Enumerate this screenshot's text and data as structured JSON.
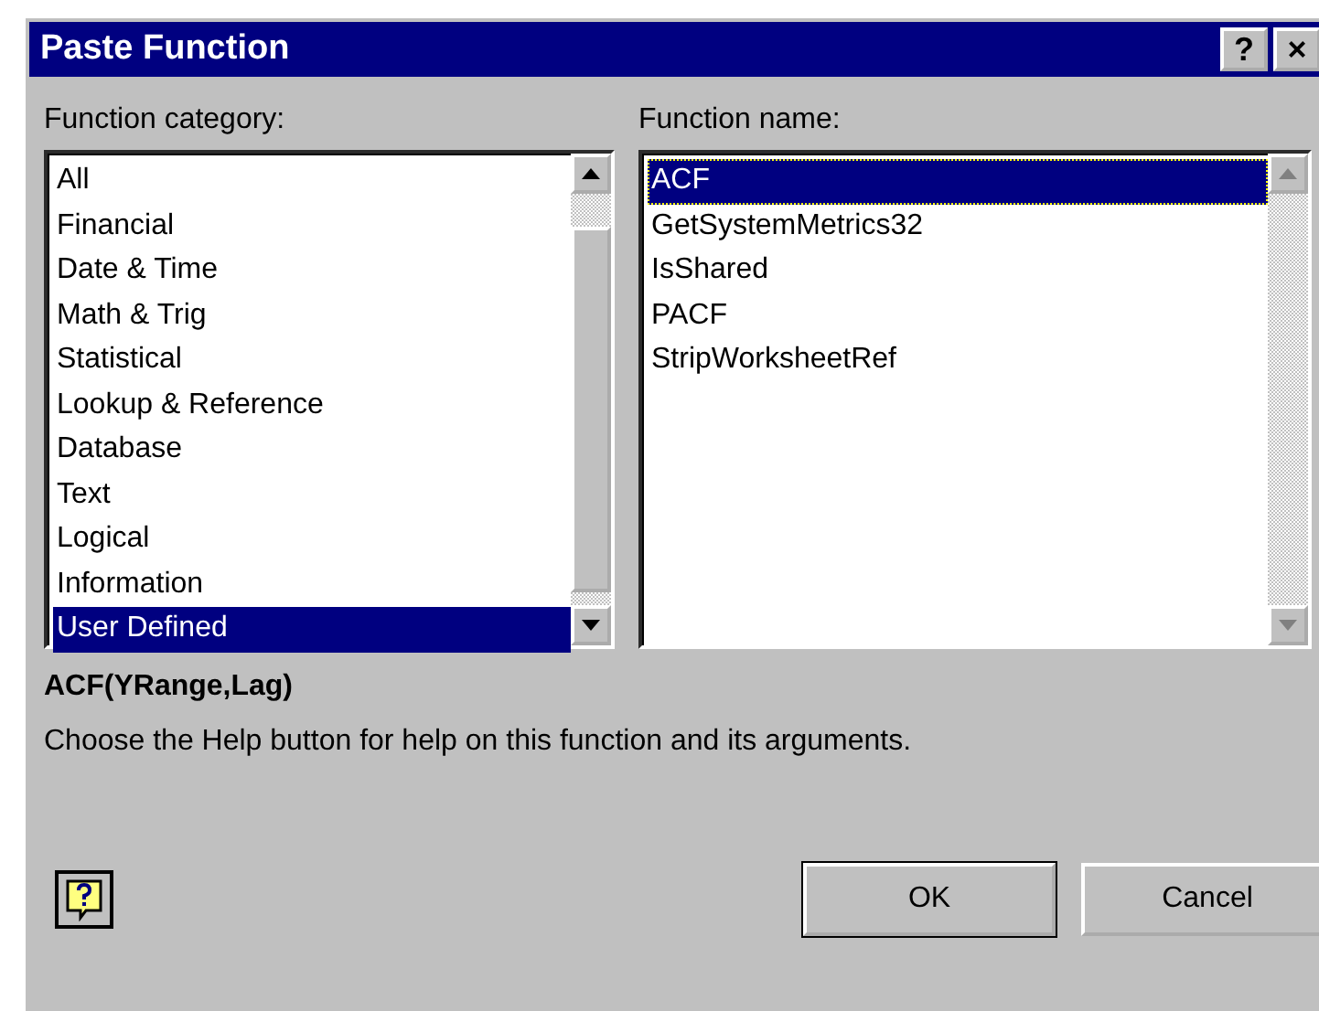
{
  "window": {
    "title": "Paste Function",
    "title_buttons": [
      "?",
      "×"
    ]
  },
  "category_list": {
    "label": "Function category:",
    "items": [
      {
        "label": "All",
        "selected": false
      },
      {
        "label": "Financial",
        "selected": false
      },
      {
        "label": "Date & Time",
        "selected": false
      },
      {
        "label": "Math & Trig",
        "selected": false
      },
      {
        "label": "Statistical",
        "selected": false
      },
      {
        "label": "Lookup & Reference",
        "selected": false
      },
      {
        "label": "Database",
        "selected": false
      },
      {
        "label": "Text",
        "selected": false
      },
      {
        "label": "Logical",
        "selected": false
      },
      {
        "label": "Information",
        "selected": false
      },
      {
        "label": "User Defined",
        "selected": true
      }
    ]
  },
  "name_list": {
    "label": "Function name:",
    "items": [
      {
        "label": "ACF",
        "selected": true
      },
      {
        "label": "GetSystemMetrics32",
        "selected": false
      },
      {
        "label": "IsShared",
        "selected": false
      },
      {
        "label": "PACF",
        "selected": false
      },
      {
        "label": "StripWorksheetRef",
        "selected": false
      }
    ]
  },
  "syntax": "ACF(YRange,Lag)",
  "description": "Choose the Help button for help on this function and its arguments.",
  "buttons": [
    "OK",
    "Cancel"
  ]
}
